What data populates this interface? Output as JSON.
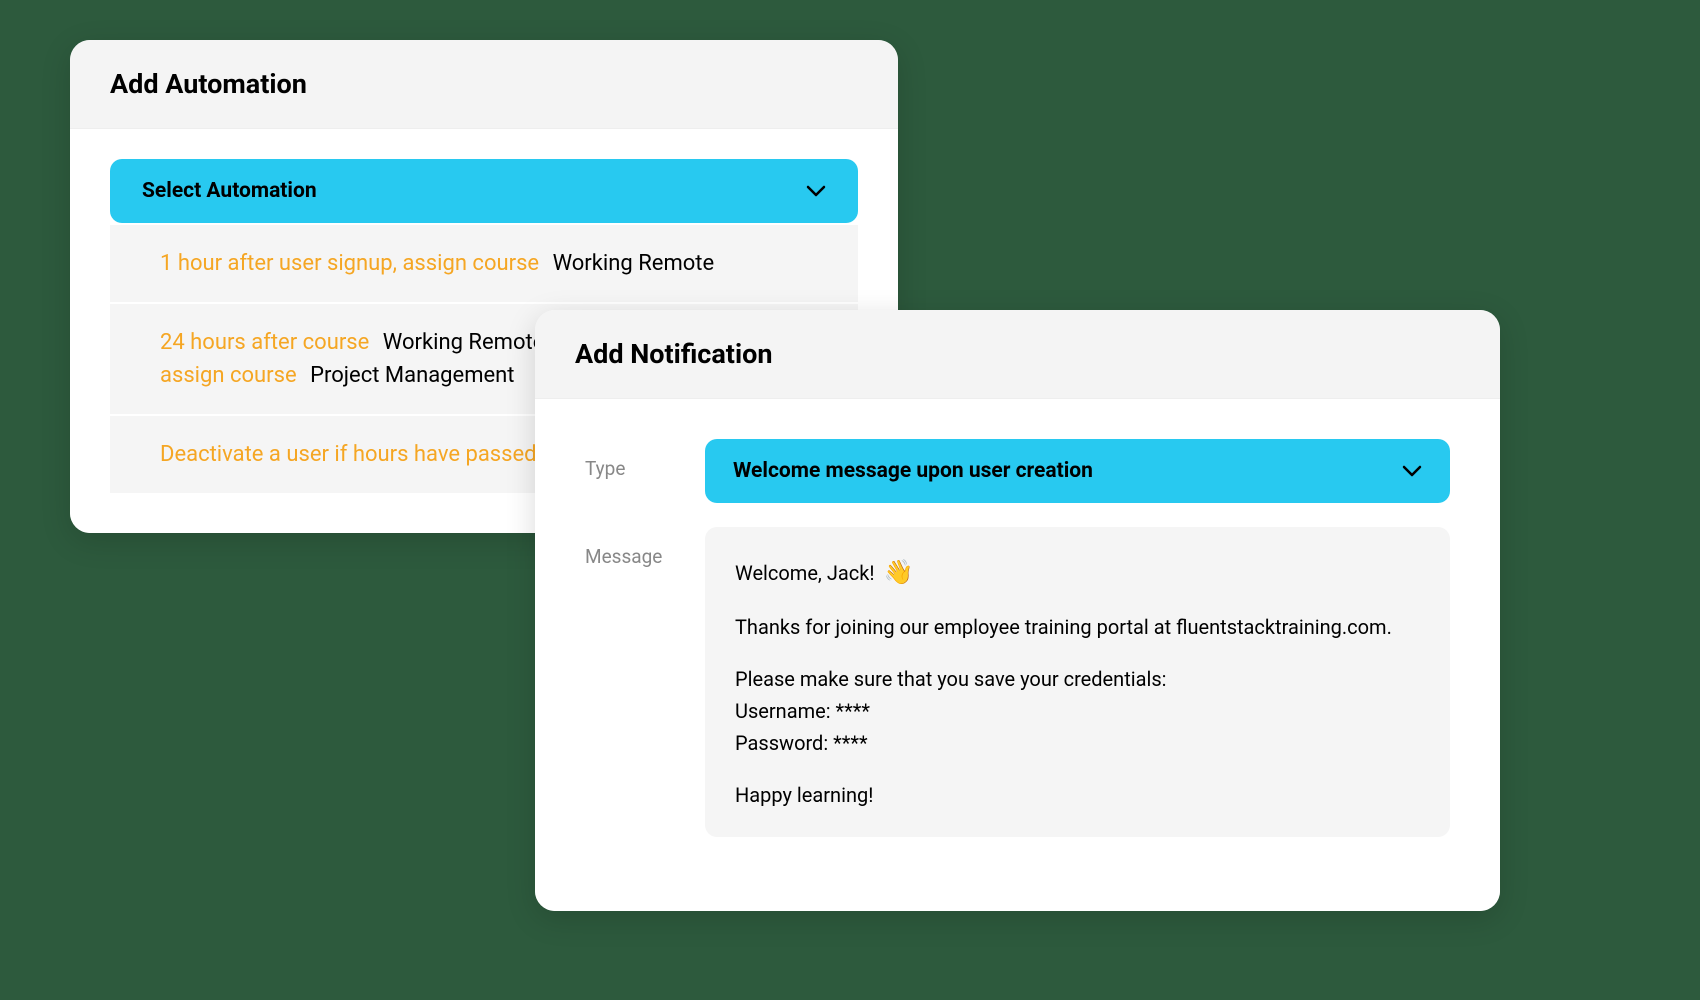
{
  "automation": {
    "title": "Add Automation",
    "select_label": "Select Automation",
    "options": [
      {
        "highlight": "1 hour after user signup, assign course",
        "value": "Working Remote"
      },
      {
        "highlight_a": "24 hours after course",
        "value_a": "Working Remote",
        "highlight_b": "assign course",
        "value_b": "Project Management"
      },
      {
        "highlight": "Deactivate a user if hours have passed",
        "value": ""
      }
    ]
  },
  "notification": {
    "title": "Add Notification",
    "type_label": "Type",
    "type_value": "Welcome message upon user creation",
    "message_label": "Message",
    "message": {
      "greeting": "Welcome, Jack!",
      "wave": "👋",
      "line1": "Thanks for joining our employee training portal at fluentstacktraining.com.",
      "line2": "Please make sure that you save your credentials:",
      "username_label": "Username: ****",
      "password_label": "Password: ****",
      "closing": "Happy learning!"
    }
  }
}
